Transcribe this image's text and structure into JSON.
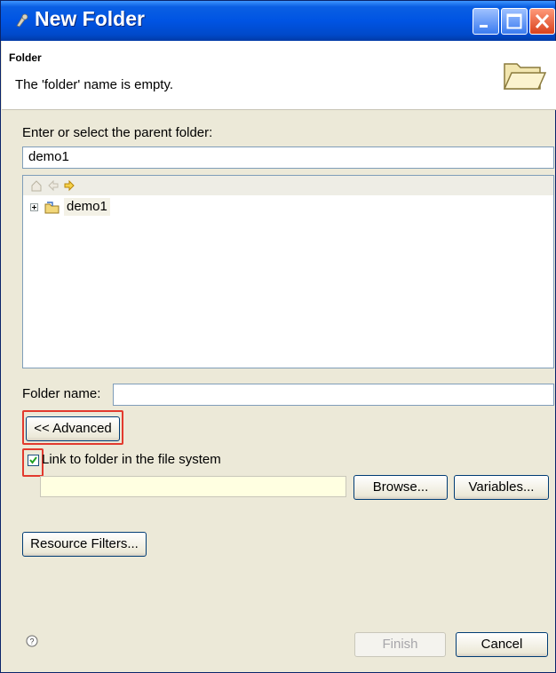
{
  "window": {
    "title": "New Folder"
  },
  "banner": {
    "title": "Folder",
    "message": "The 'folder' name is empty."
  },
  "parent": {
    "label": "Enter or select the parent folder:",
    "value": "demo1",
    "tree": [
      {
        "label": "demo1"
      }
    ]
  },
  "folder_name": {
    "label": "Folder name:",
    "value": ""
  },
  "advanced_button": "<< Advanced",
  "link": {
    "label": "Link to folder in the file system",
    "checked": true,
    "path": ""
  },
  "buttons": {
    "browse": "Browse...",
    "variables": "Variables...",
    "resource_filters": "Resource Filters...",
    "finish": "Finish",
    "cancel": "Cancel"
  },
  "colors": {
    "highlight": "#e23a2e",
    "link_path_bg": "#ffffe1"
  }
}
